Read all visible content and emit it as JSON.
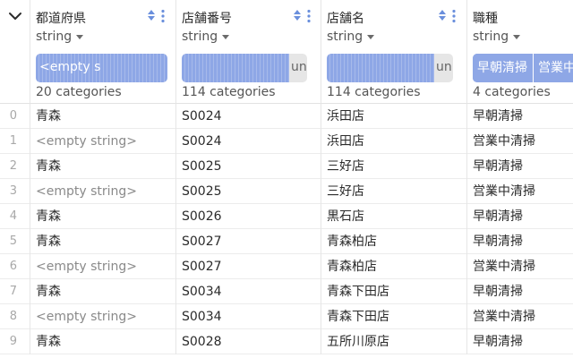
{
  "columns": [
    {
      "name": "都道府県",
      "dtype": "string",
      "hist_label": "<empty s",
      "categories": "20 categories"
    },
    {
      "name": "店舗番号",
      "dtype": "string",
      "hist_label": "uni",
      "categories": "114 categories"
    },
    {
      "name": "店舗名",
      "dtype": "string",
      "hist_label": "uni",
      "categories": "114 categories"
    },
    {
      "name": "職種",
      "dtype": "string",
      "hist_segments": [
        "早朝清掃",
        "営業中"
      ],
      "categories": "4 categories"
    }
  ],
  "rows": [
    {
      "index": "0",
      "pref": "青森",
      "store_no": "S0024",
      "store_name": "浜田店",
      "job": "早朝清掃"
    },
    {
      "index": "1",
      "pref": "<empty string>",
      "store_no": "S0024",
      "store_name": "浜田店",
      "job": "営業中清掃"
    },
    {
      "index": "2",
      "pref": "青森",
      "store_no": "S0025",
      "store_name": "三好店",
      "job": "早朝清掃"
    },
    {
      "index": "3",
      "pref": "<empty string>",
      "store_no": "S0025",
      "store_name": "三好店",
      "job": "営業中清掃"
    },
    {
      "index": "4",
      "pref": "青森",
      "store_no": "S0026",
      "store_name": "黒石店",
      "job": "早朝清掃"
    },
    {
      "index": "5",
      "pref": "青森",
      "store_no": "S0027",
      "store_name": "青森柏店",
      "job": "早朝清掃"
    },
    {
      "index": "6",
      "pref": "<empty string>",
      "store_no": "S0027",
      "store_name": "青森柏店",
      "job": "営業中清掃"
    },
    {
      "index": "7",
      "pref": "青森",
      "store_no": "S0034",
      "store_name": "青森下田店",
      "job": "早朝清掃"
    },
    {
      "index": "8",
      "pref": "<empty string>",
      "store_no": "S0034",
      "store_name": "青森下田店",
      "job": "営業中清掃"
    },
    {
      "index": "9",
      "pref": "青森",
      "store_no": "S0028",
      "store_name": "五所川原店",
      "job": "早朝清掃"
    }
  ],
  "colors": {
    "accent": "#8ea7e6",
    "icon": "#6a8fdc",
    "bar_remainder": "#e6e6e6"
  },
  "icons": {
    "collapse": "chevron-down-icon",
    "sort": "sort-icon",
    "menu": "more-vertical-icon",
    "dtype": "caret-down-icon"
  }
}
